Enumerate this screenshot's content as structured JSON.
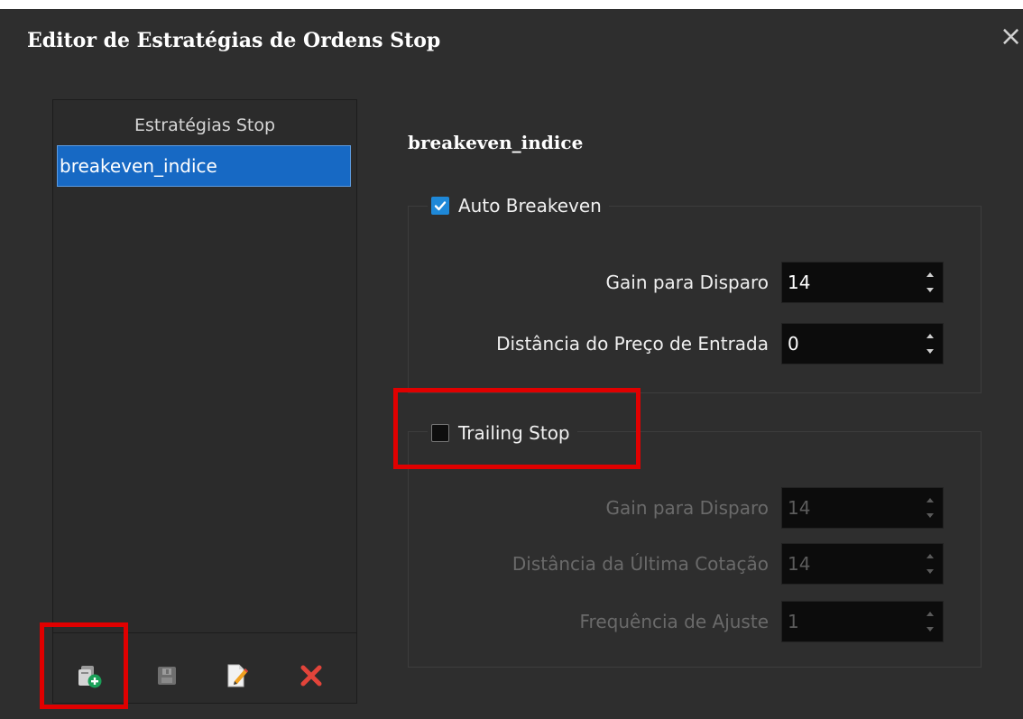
{
  "window": {
    "title": "Editor de Estratégias de Ordens Stop",
    "close_glyph": "×"
  },
  "list": {
    "header": "Estratégias Stop",
    "items": [
      {
        "label": "breakeven_indice",
        "selected": true
      }
    ],
    "toolbar": [
      {
        "icon": "add-strategy-icon",
        "enabled": true
      },
      {
        "icon": "save-icon",
        "enabled": false
      },
      {
        "icon": "edit-icon",
        "enabled": true
      },
      {
        "icon": "delete-icon",
        "enabled": true
      }
    ]
  },
  "strategy": {
    "name": "breakeven_indice",
    "auto_breakeven": {
      "label": "Auto Breakeven",
      "checked": true,
      "fields": [
        {
          "label": "Gain para Disparo",
          "value": "14"
        },
        {
          "label": "Distância do Preço de Entrada",
          "value": "0"
        }
      ]
    },
    "trailing_stop": {
      "label": "Trailing Stop",
      "checked": false,
      "fields": [
        {
          "label": "Gain para Disparo",
          "value": "14"
        },
        {
          "label": "Distância da Última Cotação",
          "value": "14"
        },
        {
          "label": "Frequência de Ajuste",
          "value": "1"
        }
      ]
    }
  },
  "colors": {
    "background": "#2e2e2e",
    "selection": "#1769c4",
    "checkbox_checked": "#1e88d8",
    "highlight": "#e00000"
  }
}
